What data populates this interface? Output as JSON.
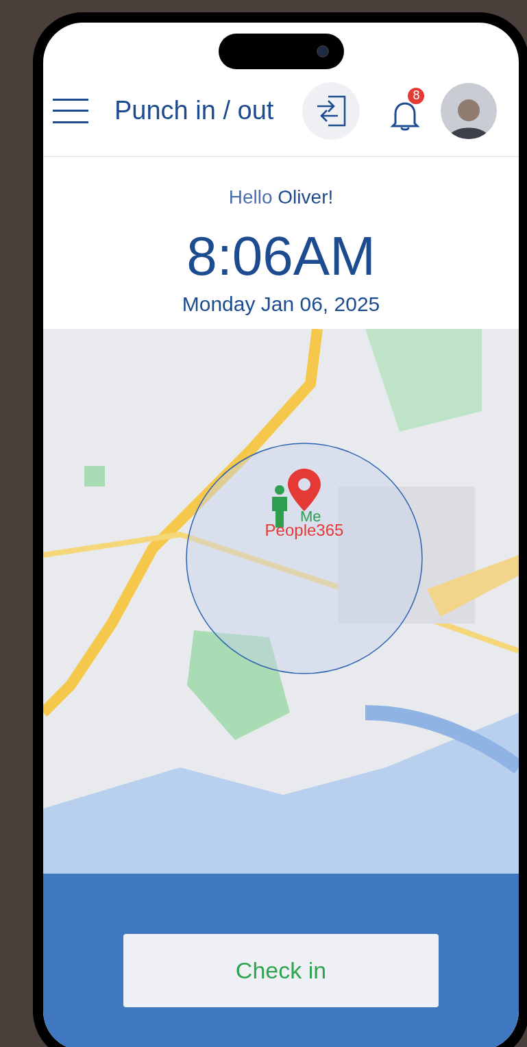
{
  "header": {
    "title": "Punch in / out",
    "notification_count": "8"
  },
  "greeting": {
    "prefix": "Hello",
    "name": "Oliver!"
  },
  "time": "8:06AM",
  "date": "Monday Jan 06, 2025",
  "map": {
    "markers": [
      {
        "kind": "person",
        "label": "Me",
        "color": "#2e9e4f"
      },
      {
        "kind": "pin",
        "label": "People365",
        "color": "#e53935"
      }
    ]
  },
  "action_button": "Check in"
}
